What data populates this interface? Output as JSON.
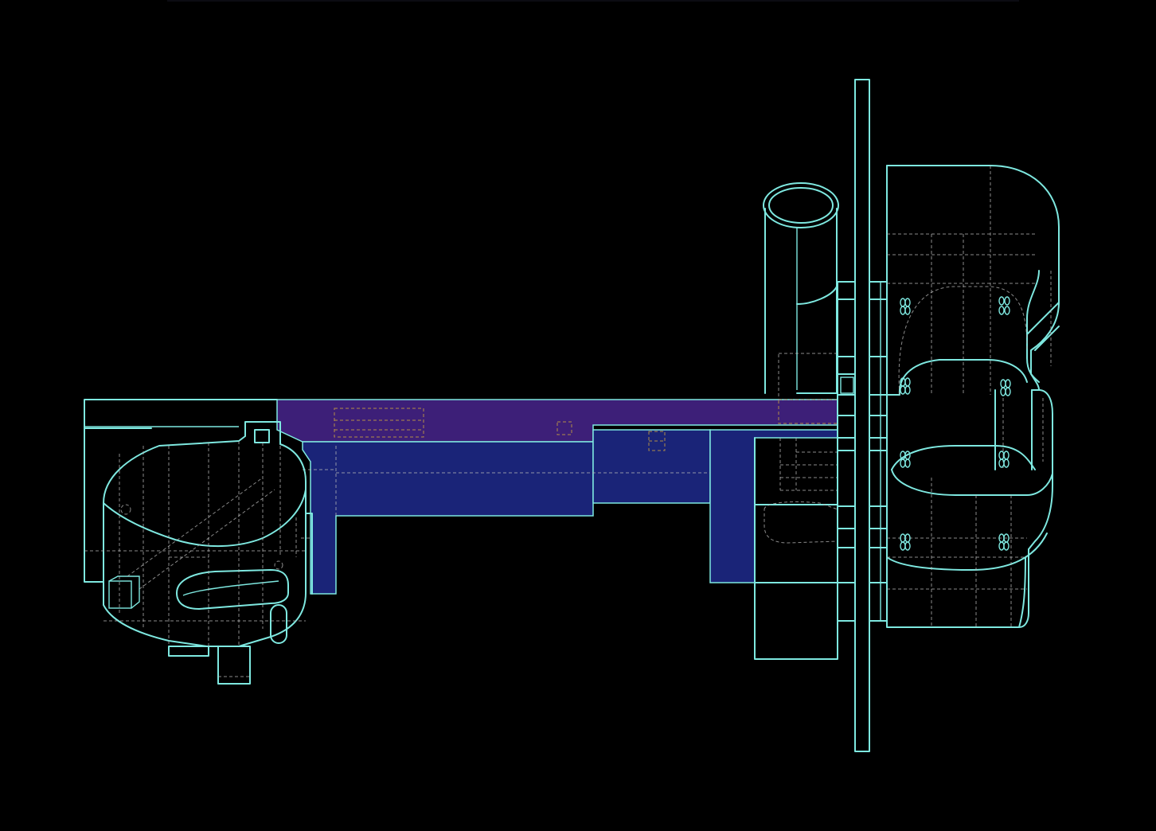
{
  "viewport": {
    "background": "#000000"
  },
  "colors": {
    "edge": "#7ee8e0",
    "hidden_edge": "#b8b8b8",
    "selected_top_face": "#3d1f78",
    "selected_front_face": "#1a2478",
    "selected_hidden_edge": "#c8a040"
  },
  "model": {
    "view": "wireframe-hidden-lines",
    "selected_part": "beam"
  }
}
